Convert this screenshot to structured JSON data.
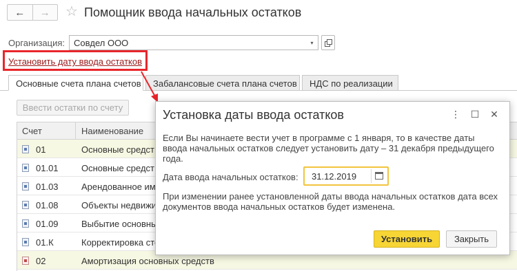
{
  "window": {
    "back_icon": "arrow-left-icon",
    "forward_icon": "arrow-right-icon",
    "favorite_icon": "star-icon",
    "favorite_glyph": "☆",
    "title": "Помощник ввода начальных остатков"
  },
  "organization": {
    "label": "Организация:",
    "value": "Совдел ООО",
    "dropdown_glyph": "▾"
  },
  "set_date_link": "Установить дату ввода остатков",
  "highlight_color": "#e8262b",
  "tabs": [
    {
      "label": "Основные счета плана счетов",
      "active": true
    },
    {
      "label": "Забалансовые счета плана счетов",
      "active": false
    },
    {
      "label": "НДС по реализации",
      "active": false
    }
  ],
  "toolbar": {
    "enter_balance_label": "Ввести остатки по счету"
  },
  "table": {
    "headers": {
      "account": "Счет",
      "name": "Наименование"
    },
    "rows": [
      {
        "code": "01",
        "name": "Основные средст",
        "highlighted": true
      },
      {
        "code": "01.01",
        "name": "Основные средст",
        "highlighted": false
      },
      {
        "code": "01.03",
        "name": "Арендованное иму",
        "highlighted": false
      },
      {
        "code": "01.08",
        "name": "Объекты недвижи",
        "highlighted": false
      },
      {
        "code": "01.09",
        "name": "Выбытие основны",
        "highlighted": false
      },
      {
        "code": "01.К",
        "name": "Корректировка сто",
        "highlighted": false
      },
      {
        "code": "02",
        "name": "Амортизация основных средств",
        "highlighted": true
      }
    ]
  },
  "dialog": {
    "title": "Установка даты ввода остатков",
    "menu_glyph": "⋮",
    "maximize_glyph": "☐",
    "close_glyph": "✕",
    "info_line1": "Если Вы начинаете вести учет в программе с 1 января, то в качестве даты",
    "info_line2": "ввода начальных остатков следует установить дату – 31 декабря предыдущего",
    "info_line3": "года.",
    "date_label": "Дата ввода начальных остатков:",
    "date_value": "31.12.2019",
    "note_line1": "При изменении ранее установленной даты ввода начальных остатков дата всех",
    "note_line2": "документов ввода начальных остатков будет изменена.",
    "install_label": "Установить",
    "close_label": "Закрыть",
    "accent_color": "#f6d535"
  }
}
